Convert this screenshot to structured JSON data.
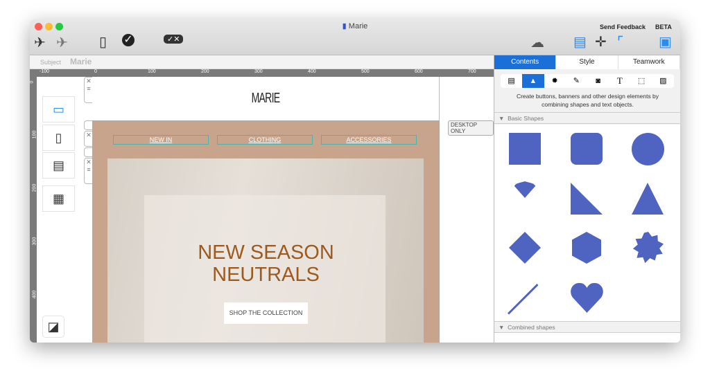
{
  "window": {
    "title": "Marie"
  },
  "toolbar": {
    "send_feedback": "Send Feedback",
    "beta": "BETA",
    "icons": [
      "send-test-icon",
      "send-campaign-icon",
      "device-preview-icon",
      "check-icon",
      "approve-reject-icon",
      "cloud-icon",
      "layout-blocks-icon",
      "move-icon",
      "ruler-icon",
      "sidebar-toggle-icon"
    ]
  },
  "subject": {
    "label": "Subject",
    "value": "Marie"
  },
  "ruler": {
    "h": [
      "-100",
      "0",
      "100",
      "200",
      "300",
      "400",
      "500",
      "600",
      "700"
    ],
    "v": [
      "0",
      "100",
      "200",
      "300",
      "400"
    ]
  },
  "email": {
    "logo": "MARIE",
    "nav": [
      "NEW IN",
      "CLOTHING",
      "ACCESSORIES"
    ],
    "headline1": "NEW SEASON",
    "headline2": "NEUTRALS",
    "cta": "SHOP THE COLLECTION",
    "desktop_badge": "DESKTOP ONLY"
  },
  "panel": {
    "tabs": [
      "Contents",
      "Style",
      "Teamwork"
    ],
    "active_tab": "Contents",
    "description": "Create buttons, banners and other design elements by combining shapes and text objects.",
    "basic_shapes": "Basic Shapes",
    "combined_shapes": "Combined shapes",
    "shape_color": "#4f63c0"
  }
}
